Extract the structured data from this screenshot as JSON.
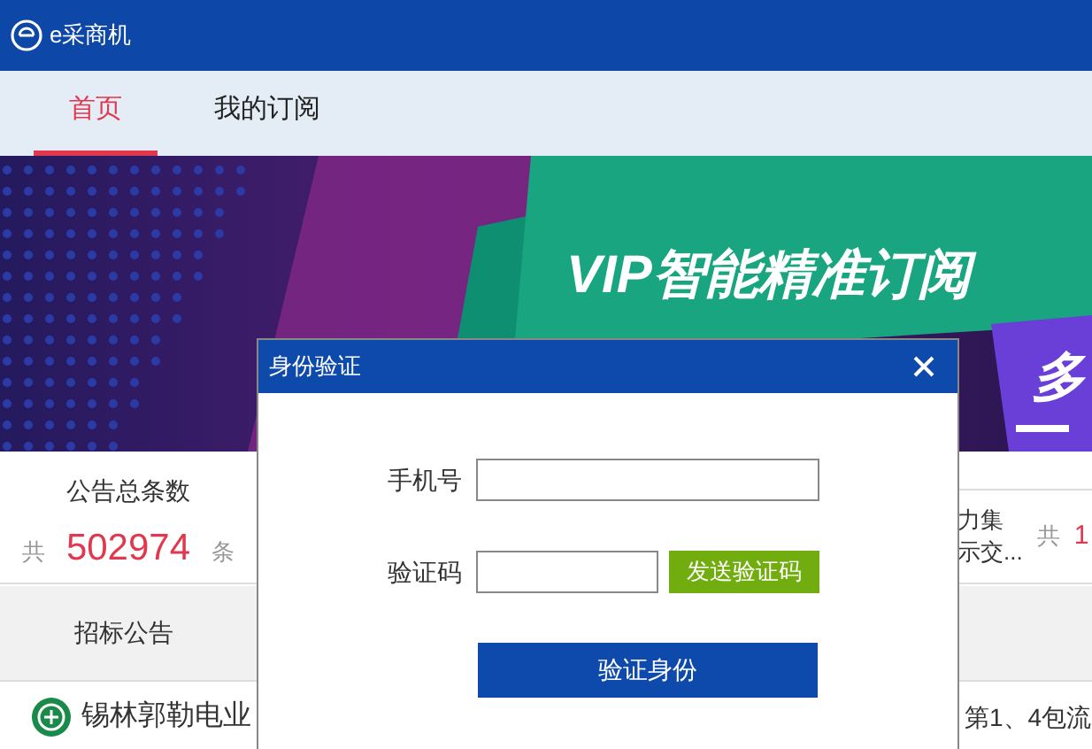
{
  "window": {
    "title": "e采商机"
  },
  "nav": {
    "tabs": [
      {
        "label": "首页",
        "selected": true
      },
      {
        "label": "我的订阅",
        "selected": false
      }
    ]
  },
  "banner": {
    "headline": "VIP智能精准订阅",
    "side_text": "多"
  },
  "stats": {
    "title": "公告总条数",
    "prefix": "共",
    "count": "502974",
    "suffix": "条",
    "partial_lines": [
      "力集",
      "示交..."
    ],
    "partial_prefix": "共",
    "partial_count": "1"
  },
  "section_tabs": [
    {
      "label": "招标公告"
    }
  ],
  "notices": [
    {
      "title_start": "锡林郭勒电业",
      "title_end": "第1、4包流"
    }
  ],
  "dialog": {
    "title": "身份验证",
    "fields": [
      {
        "kind": "text",
        "label": "手机号"
      },
      {
        "kind": "code",
        "label": "验证码",
        "button": "发送验证码"
      }
    ],
    "submit": "验证身份"
  }
}
